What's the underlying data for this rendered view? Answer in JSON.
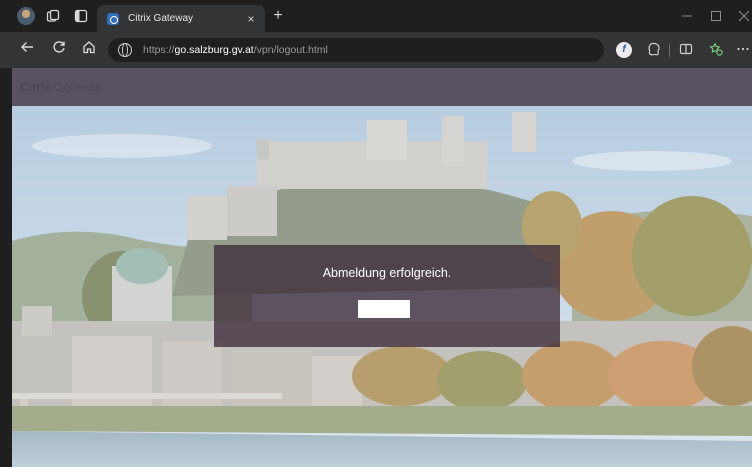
{
  "browser": {
    "tab": {
      "title": "Citrix Gateway",
      "close_glyph": "×"
    },
    "new_tab_glyph": "+",
    "address": {
      "scheme": "https://",
      "host": "go.salzburg.gv.at",
      "path": "/vpn/logout.html"
    },
    "icons": {
      "profile": "profile-avatar",
      "workspaces": "workspaces-icon",
      "tab_actions": "tab-actions-icon",
      "back": "back-arrow-icon",
      "reload": "reload-icon",
      "home": "home-icon",
      "site_info": "globe-icon",
      "extension_1": "extension-f-icon",
      "extension_2": "copilot-icon",
      "split_screen": "split-screen-icon",
      "favorites": "favorites-icon",
      "more": "more-icon"
    }
  },
  "gateway": {
    "brand": "Citrix",
    "brand_product": "Gateway"
  },
  "logout_dialog": {
    "message": "Abmeldung erfolgreich.",
    "button_label": ""
  },
  "colors": {
    "header_bg": "#5a5161",
    "dialog_bg": "#3c2c3a",
    "browser_chrome": "#1f1f1f",
    "toolbar": "#333436"
  }
}
